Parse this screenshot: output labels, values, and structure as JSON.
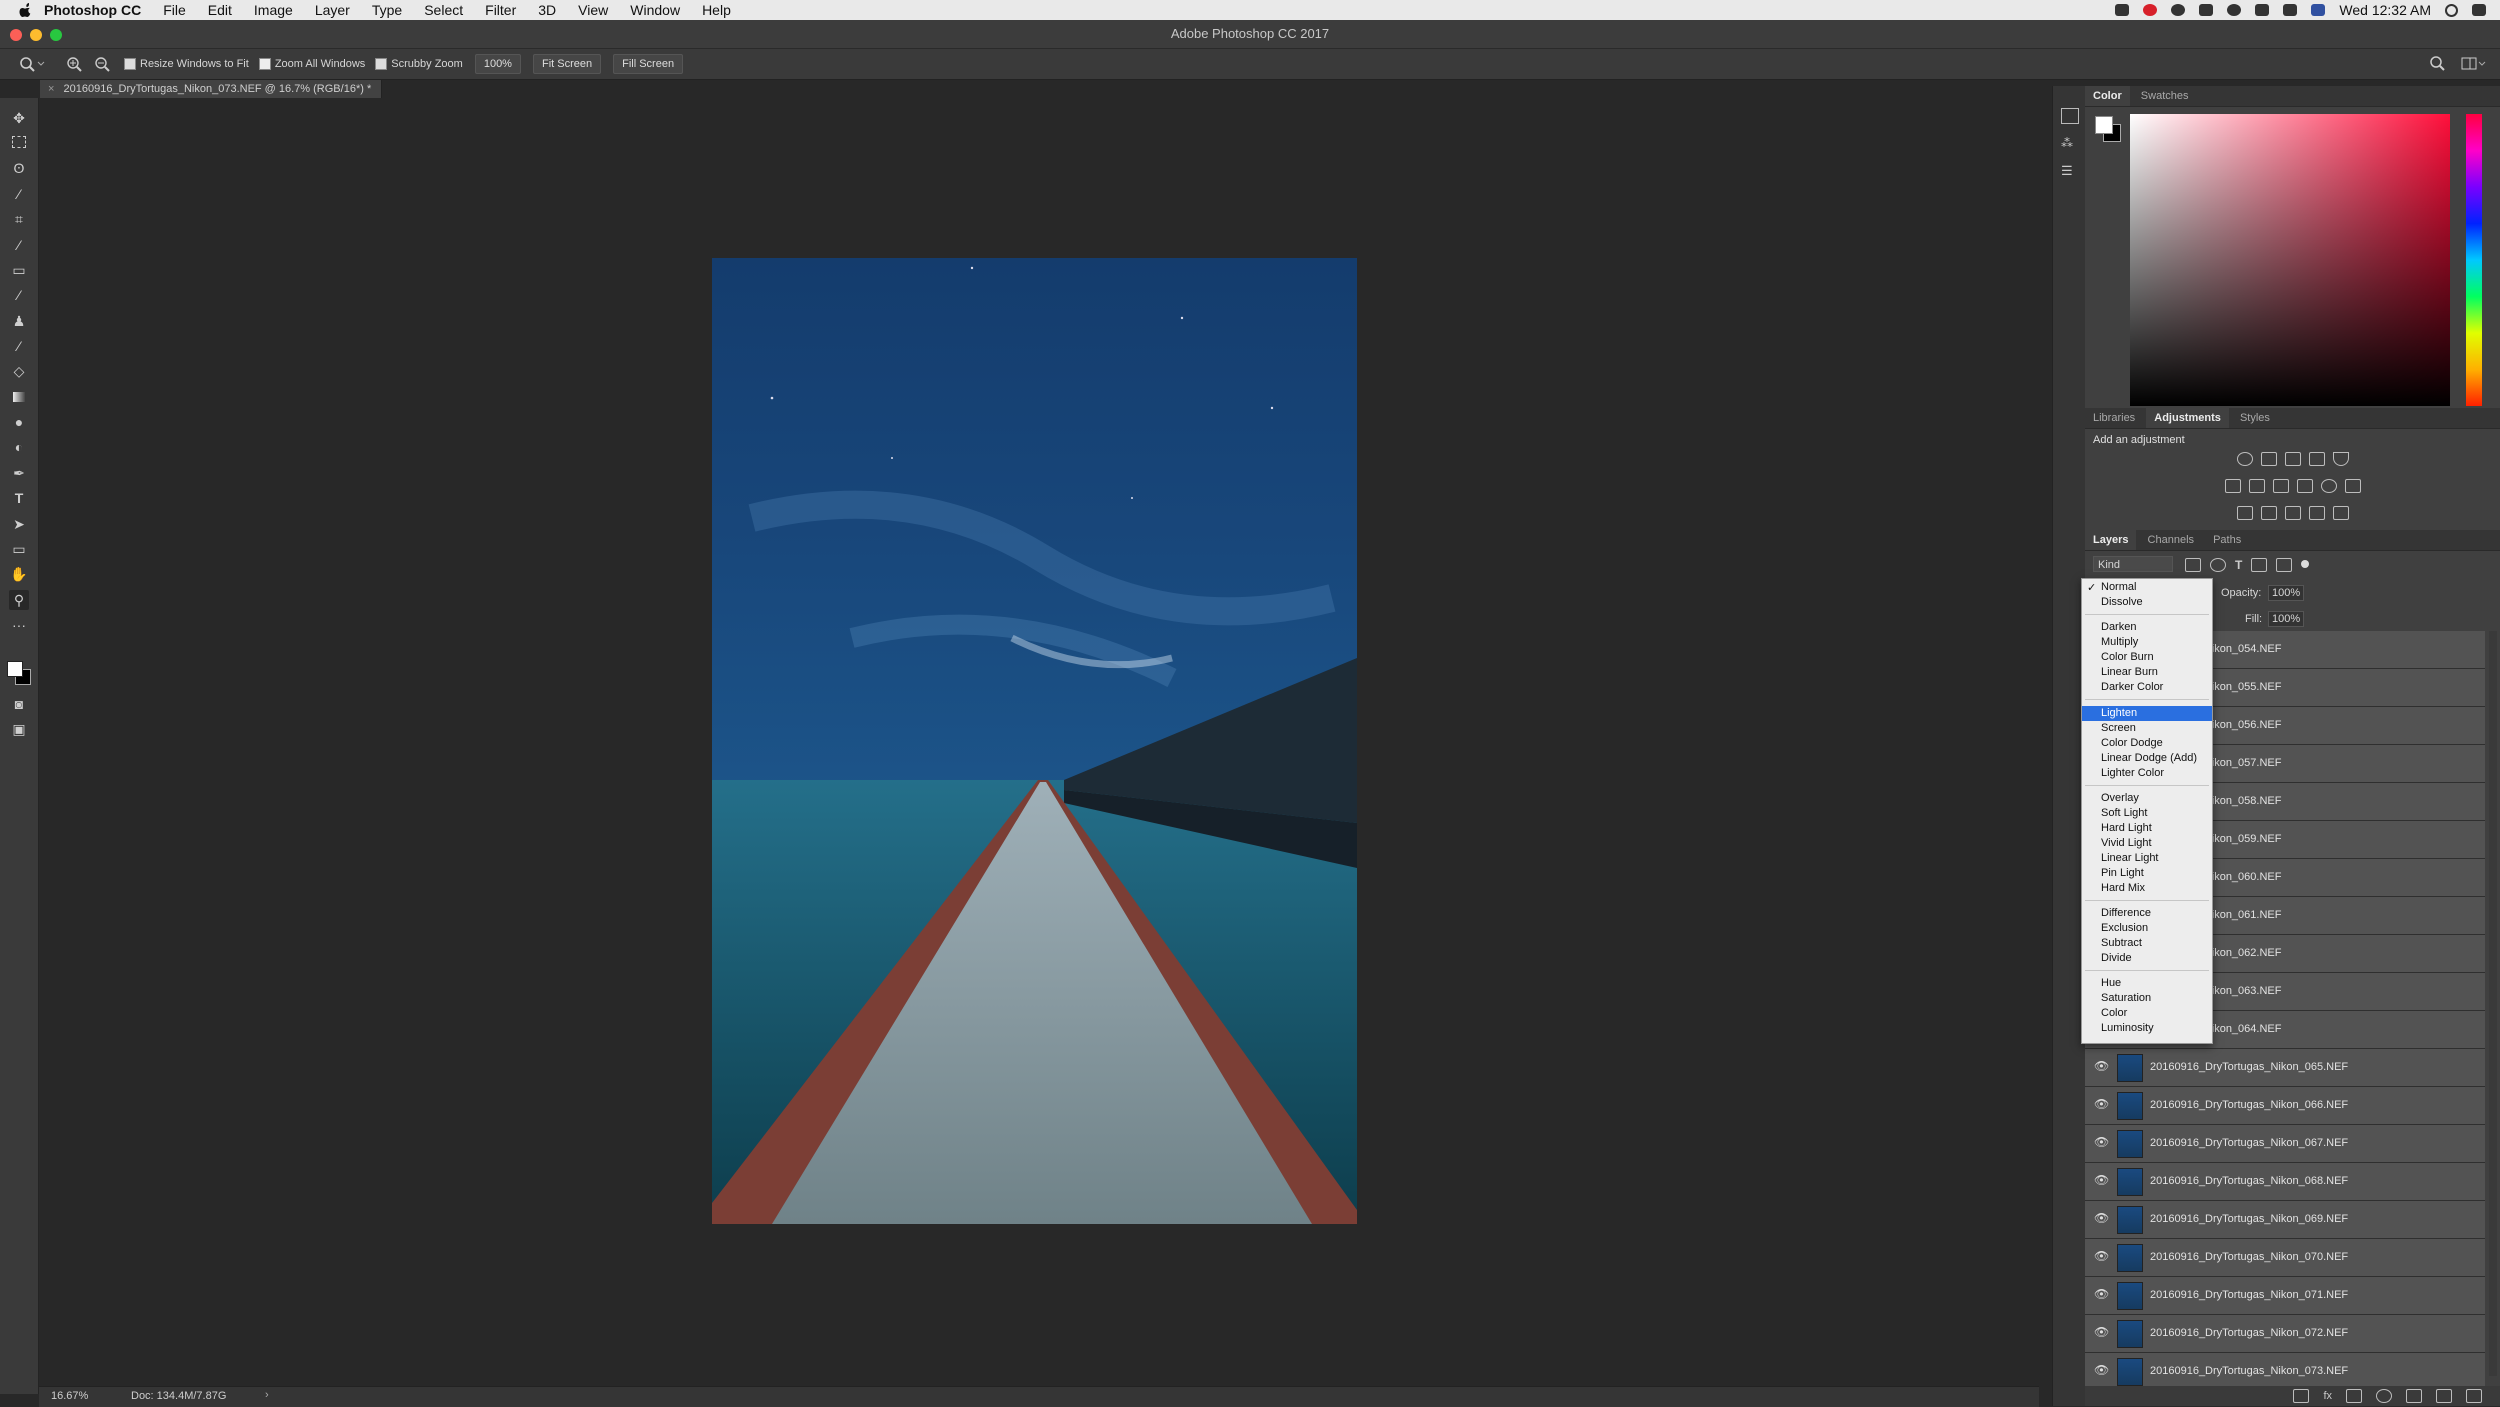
{
  "menubar": {
    "app_name": "Photoshop CC",
    "items": [
      "File",
      "Edit",
      "Image",
      "Layer",
      "Type",
      "Select",
      "Filter",
      "3D",
      "View",
      "Window",
      "Help"
    ],
    "clock": "Wed 12:32 AM"
  },
  "window": {
    "title": "Adobe Photoshop CC 2017"
  },
  "options": {
    "resize_windows": "Resize Windows to Fit",
    "zoom_all": "Zoom All Windows",
    "scrubby": "Scrubby Zoom",
    "zoom_value": "100%",
    "fit_screen": "Fit Screen",
    "fill_screen": "Fill Screen"
  },
  "document": {
    "tab": "20160916_DryTortugas_Nikon_073.NEF @ 16.7% (RGB/16*) *"
  },
  "status": {
    "zoom": "16.67%",
    "doc": "Doc: 134.4M/7.87G"
  },
  "panels": {
    "color_tabs": [
      "Color",
      "Swatches"
    ],
    "adj_tabs": [
      "Libraries",
      "Adjustments",
      "Styles"
    ],
    "adj_title": "Add an adjustment",
    "layers_tabs": [
      "Layers",
      "Channels",
      "Paths"
    ],
    "kind": "Kind",
    "opacity_label": "Opacity:",
    "opacity_value": "100%",
    "fill_label": "Fill:",
    "fill_value": "100%"
  },
  "layers": [
    "yTortugas_Nikon_054.NEF",
    "yTortugas_Nikon_055.NEF",
    "yTortugas_Nikon_056.NEF",
    "yTortugas_Nikon_057.NEF",
    "yTortugas_Nikon_058.NEF",
    "yTortugas_Nikon_059.NEF",
    "yTortugas_Nikon_060.NEF",
    "yTortugas_Nikon_061.NEF",
    "yTortugas_Nikon_062.NEF",
    "yTortugas_Nikon_063.NEF",
    "yTortugas_Nikon_064.NEF",
    "20160916_DryTortugas_Nikon_065.NEF",
    "20160916_DryTortugas_Nikon_066.NEF",
    "20160916_DryTortugas_Nikon_067.NEF",
    "20160916_DryTortugas_Nikon_068.NEF",
    "20160916_DryTortugas_Nikon_069.NEF",
    "20160916_DryTortugas_Nikon_070.NEF",
    "20160916_DryTortugas_Nikon_071.NEF",
    "20160916_DryTortugas_Nikon_072.NEF",
    "20160916_DryTortugas_Nikon_073.NEF"
  ],
  "blend_modes": [
    [
      "Normal",
      "Dissolve"
    ],
    [
      "Darken",
      "Multiply",
      "Color Burn",
      "Linear Burn",
      "Darker Color"
    ],
    [
      "Lighten",
      "Screen",
      "Color Dodge",
      "Linear Dodge (Add)",
      "Lighter Color"
    ],
    [
      "Overlay",
      "Soft Light",
      "Hard Light",
      "Vivid Light",
      "Linear Light",
      "Pin Light",
      "Hard Mix"
    ],
    [
      "Difference",
      "Exclusion",
      "Subtract",
      "Divide"
    ],
    [
      "Hue",
      "Saturation",
      "Color",
      "Luminosity"
    ]
  ],
  "blend_checked": "Normal",
  "blend_highlighted": "Lighten",
  "icons": [
    "apple-icon",
    "zoom-icon",
    "move-icon",
    "marquee-icon",
    "lasso-icon",
    "crop-icon",
    "eyedropper-icon",
    "brush-icon",
    "type-icon",
    "hand-icon",
    "eye-icon"
  ]
}
